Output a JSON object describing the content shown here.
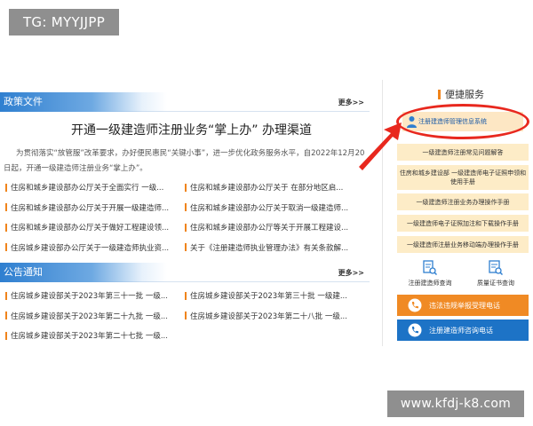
{
  "watermarks": {
    "top_left": "TG: MYYJJPP",
    "bottom_right": "www.kfdj-k8.com"
  },
  "policy": {
    "title": "政策文件",
    "more": "更多>>",
    "headline": "开通一级建造师注册业务“掌上办” 办理渠道",
    "summary": "为贯彻落实“放管服”改革要求，办好便民惠民“关键小事”，进一步优化政务服务水平，自2022年12月20日起，开通一级建造师注册业务“掌上办”。",
    "items": [
      [
        "住房和城乡建设部办公厅关于全面实行 一级...",
        "住房和城乡建设部办公厅关于 在部分地区启..."
      ],
      [
        "住房和城乡建设部办公厅关于开展一级建造师...",
        "住房和城乡建设部办公厅关于取消一级建造师..."
      ],
      [
        "住房和城乡建设部办公厅关于做好工程建设领...",
        "住房和城乡建设部办公厅等关于开展工程建设..."
      ],
      [
        "住房城乡建设部办公厅关于一级建造师执业资...",
        "关于《注册建造师执业管理办法》有关条款解..."
      ]
    ]
  },
  "notice": {
    "title": "公告通知",
    "more": "更多>>",
    "items": [
      [
        "住房城乡建设部关于2023年第三十一批 一级...",
        "住房城乡建设部关于2023年第三十批 一级建..."
      ],
      [
        "住房城乡建设部关于2023年第二十九批 一级...",
        "住房城乡建设部关于2023年第二十八批 一级..."
      ],
      [
        "住房城乡建设部关于2023年第二十七批 一级..."
      ]
    ]
  },
  "services": {
    "title": "便捷服务",
    "system_button": "注册建造师管理信息系统",
    "buttons": [
      "一级建造师注册常见问题解答",
      "住房和城乡建设部 一级建造师电子证照申领和使用手册",
      "一级建造师注册业务办理操作手册",
      "一级建造师电子证照加注和下载操作手册",
      "一级建造师注册业务移动端办理操作手册"
    ],
    "tiles": [
      {
        "label": "注册建造师查询",
        "icon": "document-search-icon"
      },
      {
        "label": "质量证书查询",
        "icon": "certificate-search-icon"
      }
    ],
    "bars": [
      {
        "label": "违法违规举报受理电话",
        "icon": "phone-icon",
        "color": "#f08a24"
      },
      {
        "label": "注册建造师咨询电话",
        "icon": "phone-icon",
        "color": "#1d73c6"
      }
    ]
  },
  "colors": {
    "accent": "#f0841b",
    "blue": "#2f7fd0",
    "highlight": "#e8281e",
    "button_bg": "#fdecc7"
  }
}
